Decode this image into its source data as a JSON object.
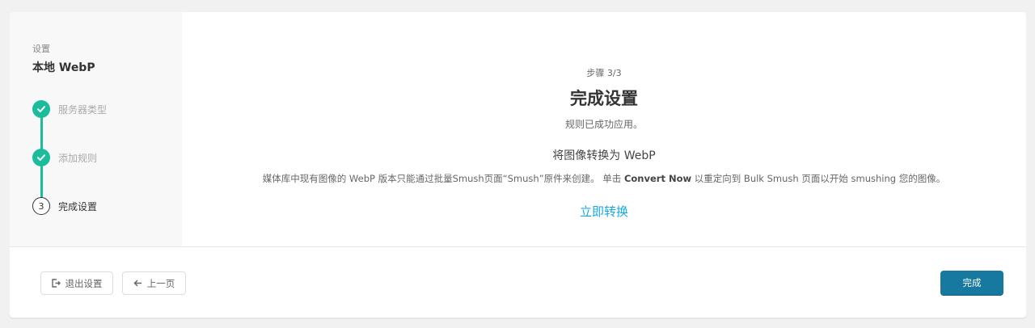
{
  "sidebar": {
    "section": "设置",
    "title": "本地 WebP",
    "steps": [
      {
        "label": "服务器类型",
        "state": "done"
      },
      {
        "label": "添加规则",
        "state": "done"
      },
      {
        "label": "完成设置",
        "state": "current",
        "number": "3"
      }
    ]
  },
  "main": {
    "step_count": "步骤 3/3",
    "title": "完成设置",
    "subtitle": "规则已成功应用。",
    "convert_heading": "将图像转换为 WebP",
    "convert_desc_1": "媒体库中现有图像的 WebP 版本只能通过批量Smush页面“Smush”原件来创建。 单击 ",
    "convert_desc_bold": "Convert Now",
    "convert_desc_2": " 以重定向到 Bulk Smush 页面以开始 smushing 您的图像。",
    "convert_link": "立即转换"
  },
  "footer": {
    "exit_label": "退出设置",
    "prev_label": "上一页",
    "finish_label": "完成"
  },
  "colors": {
    "accent": "#1abc9c",
    "primary": "#17799f",
    "link": "#17a8e3"
  }
}
